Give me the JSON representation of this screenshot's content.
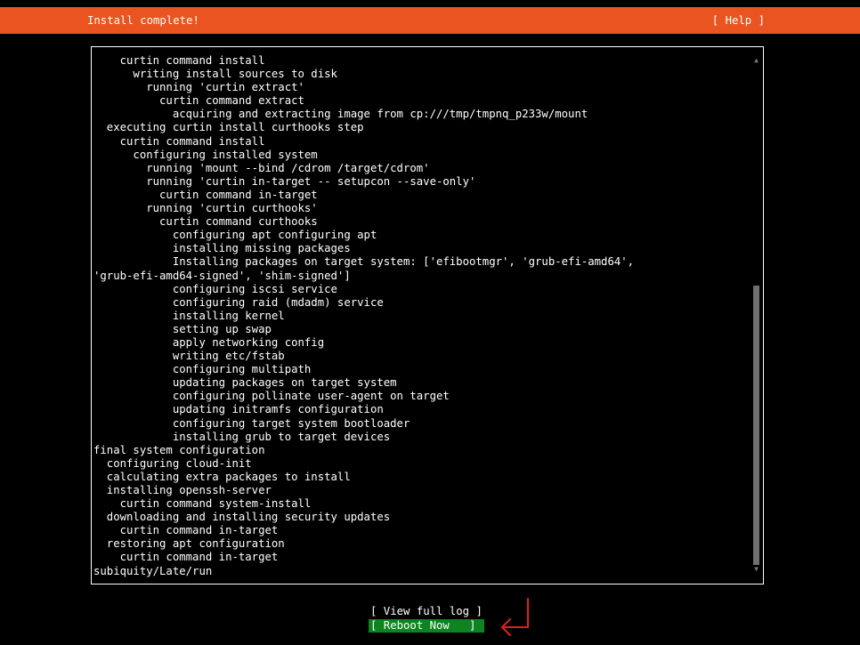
{
  "header": {
    "title": "Install complete!",
    "help_label": "[ Help ]",
    "color": "#e95420"
  },
  "log": {
    "lines": [
      "    curtin command install",
      "      writing install sources to disk",
      "        running 'curtin extract'",
      "          curtin command extract",
      "            acquiring and extracting image from cp:///tmp/tmpnq_p233w/mount",
      "  executing curtin install curthooks step",
      "    curtin command install",
      "      configuring installed system",
      "        running 'mount --bind /cdrom /target/cdrom'",
      "        running 'curtin in-target -- setupcon --save-only'",
      "          curtin command in-target",
      "        running 'curtin curthooks'",
      "          curtin command curthooks",
      "            configuring apt configuring apt",
      "            installing missing packages",
      "            Installing packages on target system: ['efibootmgr', 'grub-efi-amd64',",
      "'grub-efi-amd64-signed', 'shim-signed']",
      "            configuring iscsi service",
      "            configuring raid (mdadm) service",
      "            installing kernel",
      "            setting up swap",
      "            apply networking config",
      "            writing etc/fstab",
      "            configuring multipath",
      "            updating packages on target system",
      "            configuring pollinate user-agent on target",
      "            updating initramfs configuration",
      "            configuring target system bootloader",
      "            installing grub to target devices",
      "final system configuration",
      "  configuring cloud-init",
      "  calculating extra packages to install",
      "  installing openssh-server",
      "    curtin command system-install",
      "  downloading and installing security updates",
      "    curtin command in-target",
      "  restoring apt configuration",
      "    curtin command in-target",
      "subiquity/Late/run"
    ],
    "scroll": {
      "thumb_start": 0.44,
      "thumb_end": 1.0
    },
    "scroll_up_icon": "▲",
    "scroll_down_icon": "▼"
  },
  "actions": {
    "view_full_log_label": "[ View full log ]",
    "reboot_now_label": "[ Reboot Now   ]",
    "reboot_color": "#0e8420"
  },
  "annotation": {
    "icon": "return-arrow-icon",
    "color": "#e02020"
  }
}
